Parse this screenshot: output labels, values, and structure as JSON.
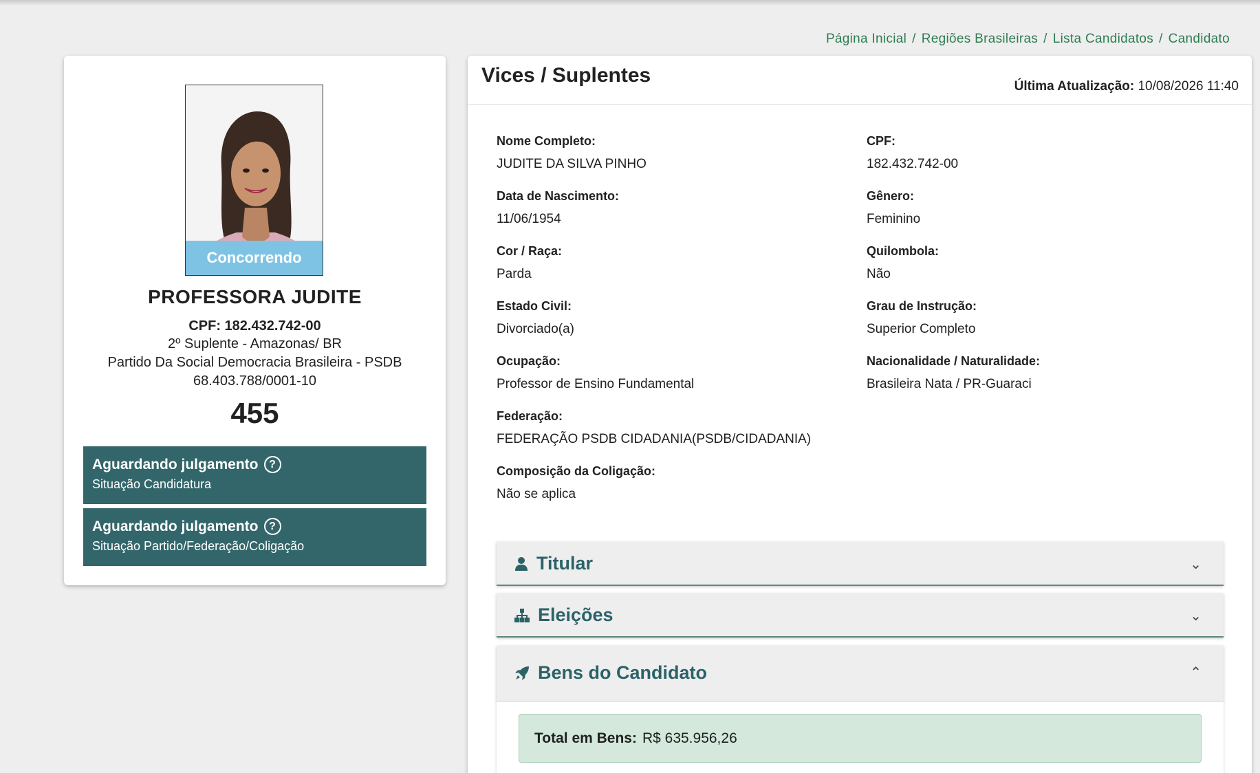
{
  "breadcrumb": [
    "Página Inicial",
    "Regiões Brasileiras",
    "Lista Candidatos",
    "Candidato"
  ],
  "profile": {
    "status_ribbon": "Concorrendo",
    "name": "PROFESSORA JUDITE",
    "cpf": "CPF: 182.432.742-00",
    "cargo": "2º Suplente - Amazonas/ BR",
    "partido": "Partido Da Social Democracia Brasileira - PSDB",
    "cnpj": "68.403.788/0001-10",
    "number": "455",
    "situacoes": [
      {
        "title": "Aguardando julgamento",
        "subtitle": "Situação Candidatura"
      },
      {
        "title": "Aguardando julgamento",
        "subtitle": "Situação Partido/Federação/Coligação"
      }
    ]
  },
  "details": {
    "title": "Vices / Suplentes",
    "last_update_label": "Última Atualização:",
    "last_update_value": "10/08/2026 11:40",
    "fields": {
      "nome": {
        "label": "Nome Completo:",
        "value": "JUDITE DA SILVA PINHO"
      },
      "cpf": {
        "label": "CPF:",
        "value": "182.432.742-00"
      },
      "nascimento": {
        "label": "Data de Nascimento:",
        "value": "11/06/1954"
      },
      "genero": {
        "label": "Gênero:",
        "value": "Feminino"
      },
      "cor": {
        "label": "Cor / Raça:",
        "value": "Parda"
      },
      "quilombola": {
        "label": "Quilombola:",
        "value": "Não"
      },
      "estado_civil": {
        "label": "Estado Civil:",
        "value": "Divorciado(a)"
      },
      "instrucao": {
        "label": "Grau de Instrução:",
        "value": "Superior Completo"
      },
      "ocupacao": {
        "label": "Ocupação:",
        "value": "Professor de Ensino Fundamental"
      },
      "nacionalidade": {
        "label": "Nacionalidade / Naturalidade:",
        "value": "Brasileira Nata / PR-Guaraci"
      },
      "federacao": {
        "label": "Federação:",
        "value": "FEDERAÇÃO PSDB CIDADANIA(PSDB/CIDADANIA)"
      },
      "coligacao": {
        "label": "Composição da Coligação:",
        "value": "Não se aplica"
      }
    },
    "accordions": {
      "titular": {
        "label": "Titular",
        "icon": "user-icon",
        "expanded": false
      },
      "eleicoes": {
        "label": "Eleições",
        "icon": "sitemap-icon",
        "expanded": false
      },
      "bens": {
        "label": "Bens do Candidato",
        "icon": "rocket-icon",
        "expanded": true
      }
    },
    "total_bens_label": "Total em Bens:",
    "total_bens_value": "R$ 635.956,26"
  },
  "colors": {
    "accent_green": "#2e7d52",
    "situacao_bg": "#33666a",
    "ribbon": "#7fc3e4",
    "accordion_text": "#2b6268"
  }
}
